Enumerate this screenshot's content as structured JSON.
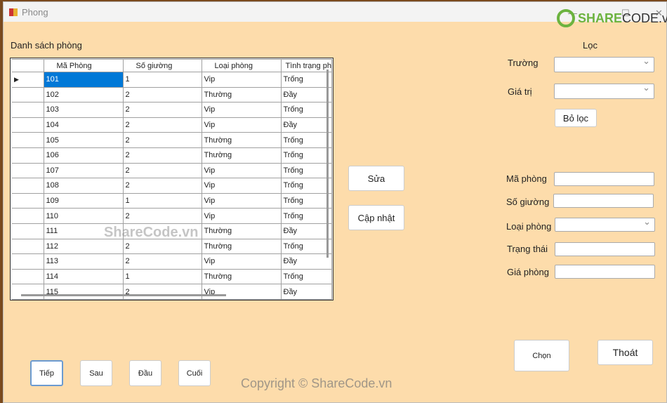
{
  "window": {
    "title": "Phong",
    "minimize": "—",
    "maximize": "☐",
    "close": "✕"
  },
  "watermark": {
    "brand_green": "SHARE",
    "brand_dark": "CODE.vn",
    "center": "ShareCode.vn",
    "footer": "Copyright © ShareCode.vn",
    "color": "#6cb33f"
  },
  "list": {
    "title": "Danh sách phòng",
    "columns": [
      "Mã Phòng",
      "Số giường",
      "Loại phòng",
      "Tình trạng ph"
    ],
    "rows": [
      [
        "101",
        "1",
        "Vip",
        "Trống"
      ],
      [
        "102",
        "2",
        "Thường",
        "Đầy"
      ],
      [
        "103",
        "2",
        "Vip",
        "Trống"
      ],
      [
        "104",
        "2",
        "Vip",
        "Đầy"
      ],
      [
        "105",
        "2",
        "Thường",
        "Trống"
      ],
      [
        "106",
        "2",
        "Thường",
        "Trống"
      ],
      [
        "107",
        "2",
        "Vip",
        "Trống"
      ],
      [
        "108",
        "2",
        "Vip",
        "Trống"
      ],
      [
        "109",
        "1",
        "Vip",
        "Trống"
      ],
      [
        "110",
        "2",
        "Vip",
        "Trống"
      ],
      [
        "111",
        "",
        "Thường",
        "Đầy"
      ],
      [
        "112",
        "2",
        "Thường",
        "Trống"
      ],
      [
        "113",
        "2",
        "Vip",
        "Đầy"
      ],
      [
        "114",
        "1",
        "Thường",
        "Trống"
      ],
      [
        "115",
        "2",
        "Vip",
        "Đầy"
      ]
    ],
    "selected_row": 0
  },
  "actions": {
    "edit": "Sửa",
    "update": "Cập nhật"
  },
  "filter": {
    "title": "Lọc",
    "field_label": "Trường",
    "field_value": "",
    "value_label": "Giá trị",
    "value_value": "",
    "clear": "Bỏ lọc"
  },
  "form": {
    "room_id_label": "Mã phòng",
    "room_id": "",
    "beds_label": "Số giường",
    "beds": "",
    "type_label": "Loại phòng",
    "type": "",
    "status_label": "Trạng thái",
    "status": "",
    "price_label": "Giá phòng",
    "price": ""
  },
  "nav": {
    "next": "Tiếp",
    "prev": "Sau",
    "first": "Đầu",
    "last": "Cuối"
  },
  "bottom": {
    "choose": "Chọn",
    "exit": "Thoát"
  }
}
